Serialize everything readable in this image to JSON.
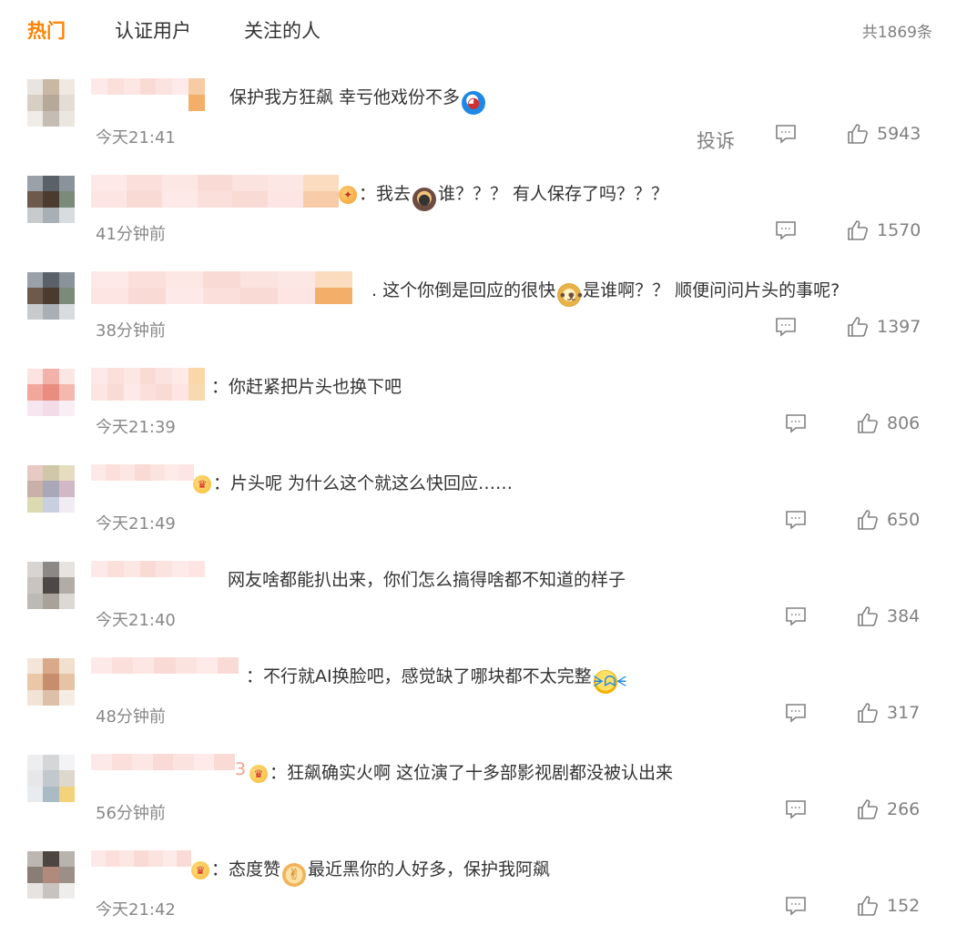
{
  "tabs": [
    {
      "label": "热门",
      "active": true
    },
    {
      "label": "认证用户",
      "active": false
    },
    {
      "label": "关注的人",
      "active": false
    }
  ],
  "total_count": "共1869条",
  "colors": {
    "accent": "#ff8200",
    "muted": "#808080"
  },
  "comments": [
    {
      "text_before": "保护我方狂飙 幸亏他戏份不多",
      "emoji": "robot-face-emoji",
      "text_after": "",
      "time": "今天21:41",
      "likes": "5943",
      "report": "投诉"
    },
    {
      "text_before": "：我去",
      "emoji": "monkey-emoji",
      "text_after": "谁？？？ 有人保存了吗？？？",
      "time": "41分钟前",
      "likes": "1570"
    },
    {
      "text_before": ". 这个你倒是回应的很快",
      "emoji": "doge-emoji",
      "text_after": "是谁啊？？ 顺便问问片头的事呢?",
      "time": "38分钟前",
      "likes": "1397"
    },
    {
      "text_before": "：你赶紧把片头也换下吧",
      "emoji": "",
      "text_after": "",
      "time": "今天21:39",
      "likes": "806"
    },
    {
      "text_before": "：片头呢 为什么这个就这么快回应……",
      "emoji": "",
      "text_after": "",
      "time": "今天21:49",
      "likes": "650"
    },
    {
      "text_before": "网友啥都能扒出来，你们怎么搞得啥都不知道的样子",
      "emoji": "",
      "text_after": "",
      "time": "今天21:40",
      "likes": "384"
    },
    {
      "text_before": "：不行就AI换脸吧，感觉缺了哪块都不太完整",
      "emoji": "laughing-tears-emoji",
      "text_after": "",
      "time": "48分钟前",
      "likes": "317"
    },
    {
      "text_before": "3",
      "emoji": "",
      "text_after": "：狂飙确实火啊 这位演了十多部影视剧都没被认出来",
      "time": "56分钟前",
      "likes": "266"
    },
    {
      "text_before": "：态度赞",
      "emoji": "thumbs-up-emoji",
      "text_after": "最近黑你的人好多，保护我阿飙",
      "time": "今天21:42",
      "likes": "152"
    }
  ]
}
